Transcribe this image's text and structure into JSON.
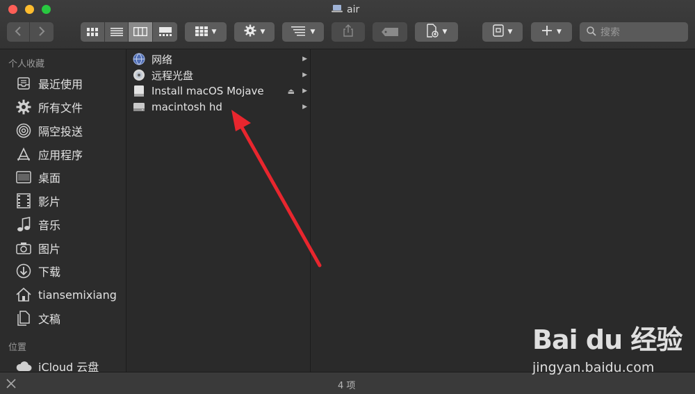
{
  "window": {
    "title": "air",
    "title_icon": "laptop-icon"
  },
  "toolbar": {
    "back_icon": "chevron-left-icon",
    "forward_icon": "chevron-right-icon",
    "view_modes": [
      "icon-view-icon",
      "list-view-icon",
      "column-view-icon",
      "gallery-view-icon"
    ],
    "active_view": "column",
    "group_icon": "group-grid-icon",
    "action_icon": "gear-icon",
    "arrange_icon": "arrange-icon",
    "share_icon": "share-icon",
    "tag_icon": "tag-icon",
    "new_doc_icon": "new-document-icon",
    "archive_icon": "archive-icon",
    "add_icon": "plus-icon",
    "search_placeholder": "搜索"
  },
  "sidebar": {
    "favorites_header": "个人收藏",
    "items": [
      {
        "label": "最近使用",
        "icon": "recents-icon"
      },
      {
        "label": "所有文件",
        "icon": "all-files-icon"
      },
      {
        "label": "隔空投送",
        "icon": "airdrop-icon"
      },
      {
        "label": "应用程序",
        "icon": "applications-icon"
      },
      {
        "label": "桌面",
        "icon": "desktop-icon"
      },
      {
        "label": "影片",
        "icon": "movies-icon"
      },
      {
        "label": "音乐",
        "icon": "music-icon"
      },
      {
        "label": "图片",
        "icon": "pictures-icon"
      },
      {
        "label": "下载",
        "icon": "downloads-icon"
      },
      {
        "label": "tiansemixiang",
        "icon": "home-icon"
      },
      {
        "label": "文稿",
        "icon": "documents-icon"
      }
    ],
    "locations_header": "位置",
    "locations": [
      {
        "label": "iCloud 云盘",
        "icon": "icloud-icon"
      }
    ]
  },
  "column": {
    "items": [
      {
        "label": "网络",
        "icon": "network-icon"
      },
      {
        "label": "远程光盘",
        "icon": "remote-disc-icon"
      },
      {
        "label": "Install macOS Mojave",
        "icon": "disk-icon"
      },
      {
        "label": "macintosh hd",
        "icon": "hard-drive-icon"
      }
    ]
  },
  "statusbar": {
    "item_count": "4 项"
  },
  "watermark": {
    "brand": "Bai du 经验",
    "url": "jingyan.baidu.com"
  },
  "colors": {
    "annotation_arrow": "#e8262e",
    "close": "#ff5f57",
    "minimize": "#febc2e",
    "maximize": "#28c840"
  }
}
